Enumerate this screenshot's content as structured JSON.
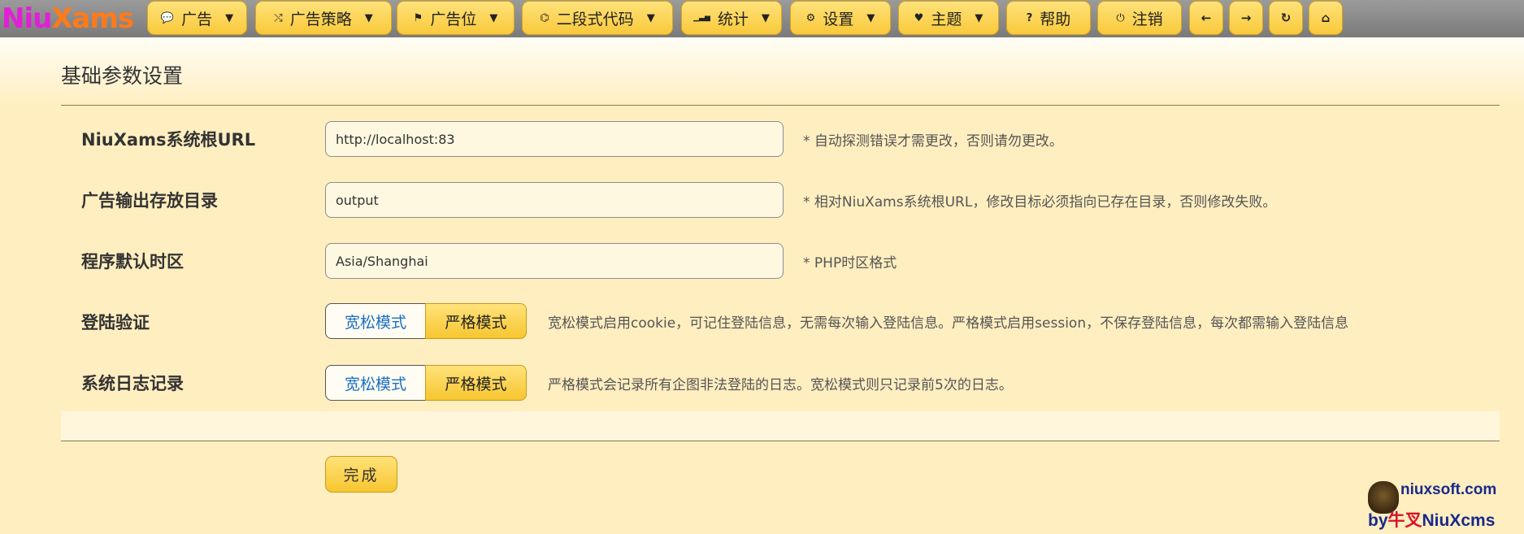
{
  "logo": {
    "part_a": "Niu",
    "part_b": "Xams"
  },
  "nav": {
    "items": [
      {
        "icon": "comment-icon",
        "glyph": "💬",
        "label": "广告",
        "dropdown": true
      },
      {
        "icon": "shuffle-icon",
        "glyph": "⤭",
        "label": "广告策略",
        "dropdown": true
      },
      {
        "icon": "flag-icon",
        "glyph": "⚑",
        "label": "广告位",
        "dropdown": true
      },
      {
        "icon": "code-icon",
        "glyph": "⌬",
        "label": "二段式代码",
        "dropdown": true
      },
      {
        "icon": "signal-icon",
        "glyph": "▁▃▅",
        "label": "统计",
        "dropdown": true
      },
      {
        "icon": "gear-icon",
        "glyph": "⚙",
        "label": "设置",
        "dropdown": true
      },
      {
        "icon": "heart-icon",
        "glyph": "♥",
        "label": "主题",
        "dropdown": true
      },
      {
        "icon": "question-icon",
        "glyph": "?",
        "label": "帮助",
        "dropdown": false
      },
      {
        "icon": "power-icon",
        "glyph": "⏻",
        "label": "注销",
        "dropdown": false
      }
    ],
    "back_glyph": "←",
    "forward_glyph": "→",
    "refresh_glyph": "↻",
    "home_glyph": "⌂",
    "caret": "▼"
  },
  "page_title": "基础参数设置",
  "fields": {
    "root_url": {
      "label": "NiuXams系统根URL",
      "value": "http://localhost:83",
      "hint": "* 自动探测错误才需更改，否则请勿更改。"
    },
    "output_dir": {
      "label": "广告输出存放目录",
      "value": "output",
      "hint": "* 相对NiuXams系统根URL，修改目标必须指向已存在目录，否则修改失败。"
    },
    "timezone": {
      "label": "程序默认时区",
      "value": "Asia/Shanghai",
      "hint": "* PHP时区格式"
    },
    "login_auth": {
      "label": "登陆验证",
      "option_loose": "宽松模式",
      "option_strict": "严格模式",
      "selected": "严格模式",
      "hint": "宽松模式启用cookie，可记住登陆信息，无需每次输入登陆信息。严格模式启用session，不保存登陆信息，每次都需输入登陆信息"
    },
    "system_log": {
      "label": "系统日志记录",
      "option_loose": "宽松模式",
      "option_strict": "严格模式",
      "selected": "严格模式",
      "hint": "严格模式会记录所有企图非法登陆的日志。宽松模式则只记录前5次的日志。"
    }
  },
  "submit_label": "完成",
  "brand": {
    "site": "niuxsoft.com",
    "by_prefix": "by",
    "by_cn": "牛叉",
    "by_name": "NiuXcms"
  },
  "colors": {
    "background": "#ffeec0",
    "button_gold": "#f9c93a",
    "toolbar_gray": "#8a8a8a",
    "logo_magenta": "#e21fd6",
    "logo_orange": "#ff7a1a",
    "link_blue": "#1a6fc4"
  }
}
